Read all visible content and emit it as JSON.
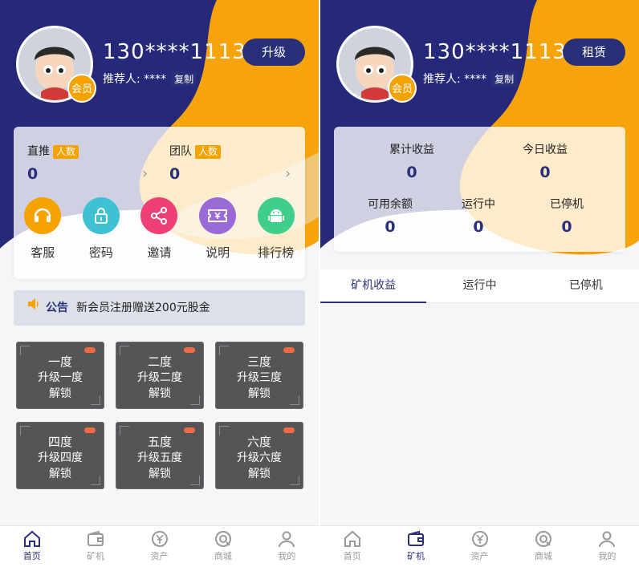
{
  "panel1": {
    "phone": "130****1113",
    "referrer": "推荐人: ****",
    "copy_label": "复制",
    "vip_label": "会员",
    "top_button": "升级",
    "stats": [
      {
        "label": "直推",
        "badge": "人数",
        "value": "0"
      },
      {
        "label": "团队",
        "badge": "人数",
        "value": "0"
      }
    ],
    "shortcuts": [
      {
        "label": "客服",
        "icon": "headset-icon",
        "color": "#f5a300"
      },
      {
        "label": "密码",
        "icon": "lock-icon",
        "color": "#3ec1d3"
      },
      {
        "label": "邀请",
        "icon": "share-icon",
        "color": "#ef3f74"
      },
      {
        "label": "说明",
        "icon": "ticket-icon",
        "color": "#9a6bd6"
      },
      {
        "label": "排行榜",
        "icon": "android-icon",
        "color": "#3fcf8a"
      }
    ],
    "notice": {
      "title": "公告",
      "text": "新会员注册赠送200元股金"
    },
    "levels": [
      {
        "name": "一度",
        "action": "升级一度",
        "status": "解锁"
      },
      {
        "name": "二度",
        "action": "升级二度",
        "status": "解锁"
      },
      {
        "name": "三度",
        "action": "升级三度",
        "status": "解锁"
      },
      {
        "name": "四度",
        "action": "升级四度",
        "status": "解锁"
      },
      {
        "name": "五度",
        "action": "升级五度",
        "status": "解锁"
      },
      {
        "name": "六度",
        "action": "升级六度",
        "status": "解锁"
      }
    ],
    "nav": [
      {
        "label": "首页",
        "icon": "home-icon",
        "active": true
      },
      {
        "label": "矿机",
        "icon": "wallet-icon",
        "active": false
      },
      {
        "label": "资产",
        "icon": "yen-icon",
        "active": false
      },
      {
        "label": "商城",
        "icon": "shop-icon",
        "active": false
      },
      {
        "label": "我的",
        "icon": "user-icon",
        "active": false
      }
    ]
  },
  "panel2": {
    "phone": "130****1113",
    "referrer": "推荐人: ****",
    "copy_label": "复制",
    "vip_label": "会员",
    "top_button": "租赁",
    "stats": [
      {
        "label": "累计收益",
        "value": "0"
      },
      {
        "label": "今日收益",
        "value": "0"
      },
      {
        "label": "可用余额",
        "value": "0"
      },
      {
        "label": "运行中",
        "value": "0"
      },
      {
        "label": "已停机",
        "value": "0"
      }
    ],
    "tabs": [
      {
        "label": "矿机收益",
        "active": true
      },
      {
        "label": "运行中",
        "active": false
      },
      {
        "label": "已停机",
        "active": false
      }
    ],
    "nav": [
      {
        "label": "首页",
        "icon": "home-icon",
        "active": false
      },
      {
        "label": "矿机",
        "icon": "wallet-icon",
        "active": true
      },
      {
        "label": "资产",
        "icon": "yen-icon",
        "active": false
      },
      {
        "label": "商城",
        "icon": "shop-icon",
        "active": false
      },
      {
        "label": "我的",
        "icon": "user-icon",
        "active": false
      }
    ]
  },
  "colors": {
    "navy": "#2a2f7a",
    "orange": "#f5a300",
    "tile": "#555558",
    "accent_dot": "#f06a45"
  }
}
